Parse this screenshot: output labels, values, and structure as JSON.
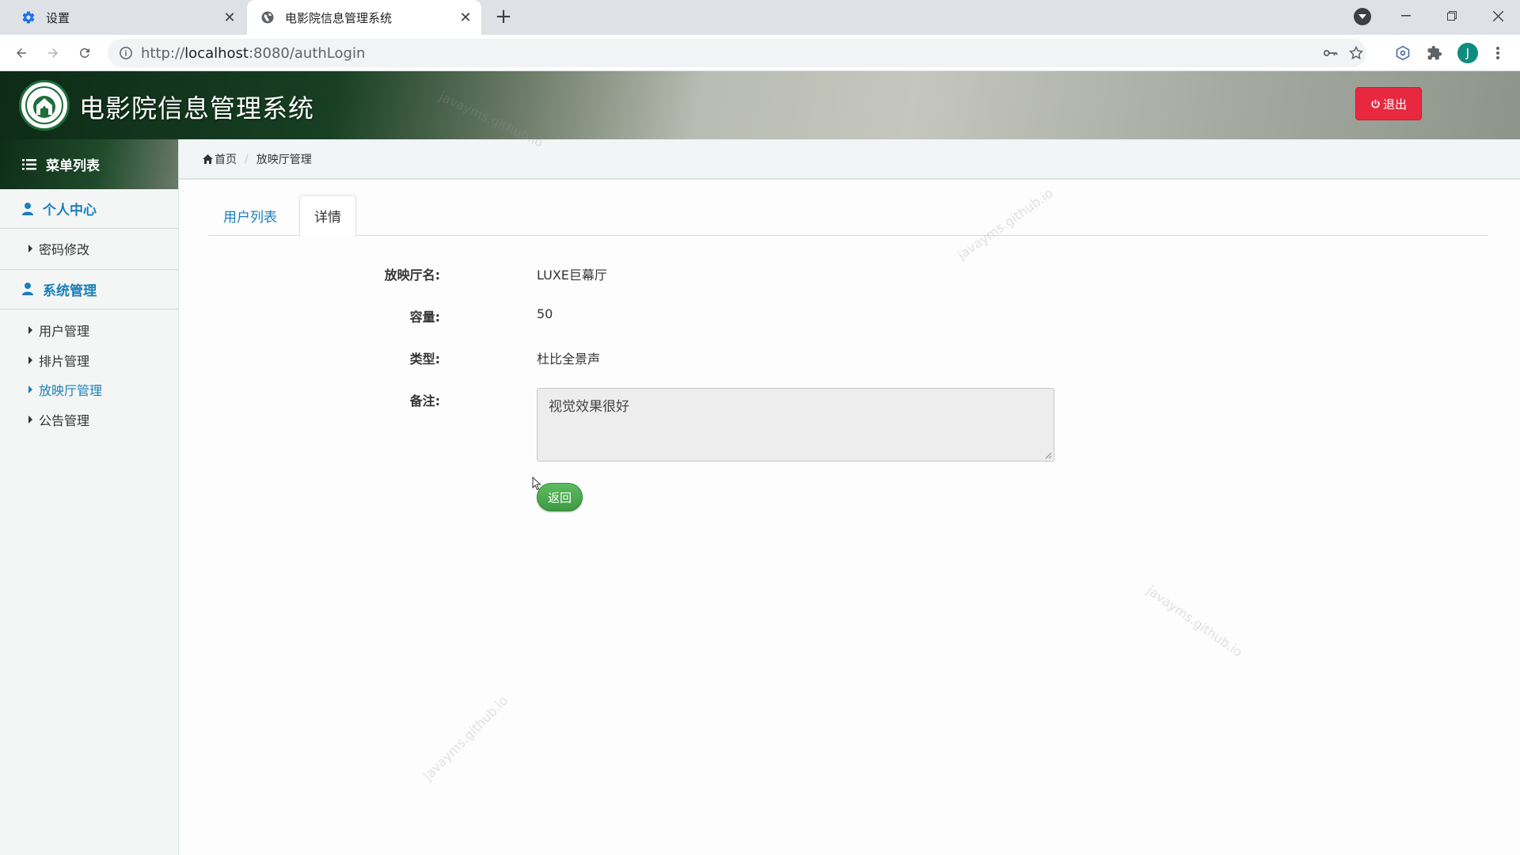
{
  "browser": {
    "tabs": [
      {
        "title": "设置",
        "icon": "gear-icon",
        "active": false
      },
      {
        "title": "电影院信息管理系统",
        "icon": "globe-icon",
        "active": true
      }
    ],
    "new_tab": "+",
    "url_prefix": "http://",
    "url_host": "localhost",
    "url_rest": ":8080/authLogin",
    "avatar_letter": "J"
  },
  "header": {
    "app_title": "电影院信息管理系统",
    "logout_label": "退出"
  },
  "sidebar": {
    "menu_title": "菜单列表",
    "groups": [
      {
        "label": "个人中心",
        "items": [
          {
            "label": "密码修改"
          }
        ]
      },
      {
        "label": "系统管理",
        "items": [
          {
            "label": "用户管理"
          },
          {
            "label": "排片管理"
          },
          {
            "label": "放映厅管理",
            "active": true
          },
          {
            "label": "公告管理"
          }
        ]
      }
    ]
  },
  "breadcrumb": {
    "home": "首页",
    "current": "放映厅管理"
  },
  "tabs": [
    {
      "label": "用户列表",
      "active": false
    },
    {
      "label": "详情",
      "active": true
    }
  ],
  "detail": {
    "name_label": "放映厅名:",
    "name_value": "LUXE巨幕厅",
    "capacity_label": "容量:",
    "capacity_value": "50",
    "type_label": "类型:",
    "type_value": "杜比全景声",
    "remark_label": "备注:",
    "remark_value": "视觉效果很好",
    "back_label": "返回"
  },
  "watermark": "javayms.github.io",
  "colors": {
    "accent": "#1a7fb8",
    "logout": "#e8283f",
    "back_button": "#4caf50"
  }
}
